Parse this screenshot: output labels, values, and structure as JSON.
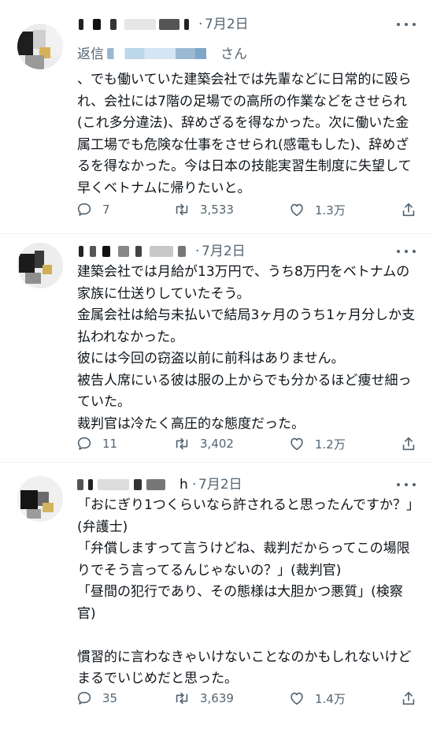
{
  "tweets": [
    {
      "date": "7月2日",
      "dot": "·",
      "reply_prefix": "返信",
      "reply_suffix": "さん",
      "text": "、でも働いていた建築会社では先輩などに日常的に殴られ、会社には7階の足場での高所の作業などをさせられ(これ多分違法)、辞めざるを得なかった。次に働いた金属工場でも危険な仕事をさせられ(感電もした)、辞めざるを得なかった。今は日本の技能実習生制度に失望して早くベトナムに帰りたいと。",
      "replies": "7",
      "retweets": "3,533",
      "likes": "1.3万"
    },
    {
      "date": "7月2日",
      "dot": "·",
      "text": "建築会社では月給が13万円で、うち8万円をベトナムの家族に仕送りしていたそう。\n金属会社は給与未払いで結局3ヶ月のうち1ヶ月分しか支払われなかった。\n彼には今回の窃盗以前に前科はありません。\n被告人席にいる彼は服の上からでも分かるほど痩せ細っていた。\n裁判官は冷たく高圧的な態度だった。",
      "replies": "11",
      "retweets": "3,402",
      "likes": "1.2万"
    },
    {
      "date": "7月2日",
      "dot": "·",
      "name_tail": "h",
      "text": "「おにぎり1つくらいなら許されると思ったんですか？」(弁護士)\n「弁償しますって言うけどね、裁判だからってこの場限りでそう言ってるんじゃないの？」(裁判官)\n「昼間の犯行であり、その態様は大胆かつ悪質」(検察官)\n\n慣習的に言わなきゃいけないことなのかもしれないけどまるでいじめだと思った。",
      "replies": "35",
      "retweets": "3,639",
      "likes": "1.4万"
    }
  ],
  "icons": {
    "more": "more-horizontal-icon",
    "reply": "reply-bubble-icon",
    "retweet": "retweet-icon",
    "like": "heart-icon",
    "share": "share-upload-icon"
  },
  "colors": {
    "text": "#0f1419",
    "secondary": "#536471",
    "link": "#1d9bf0",
    "divider": "#eff3f4"
  }
}
